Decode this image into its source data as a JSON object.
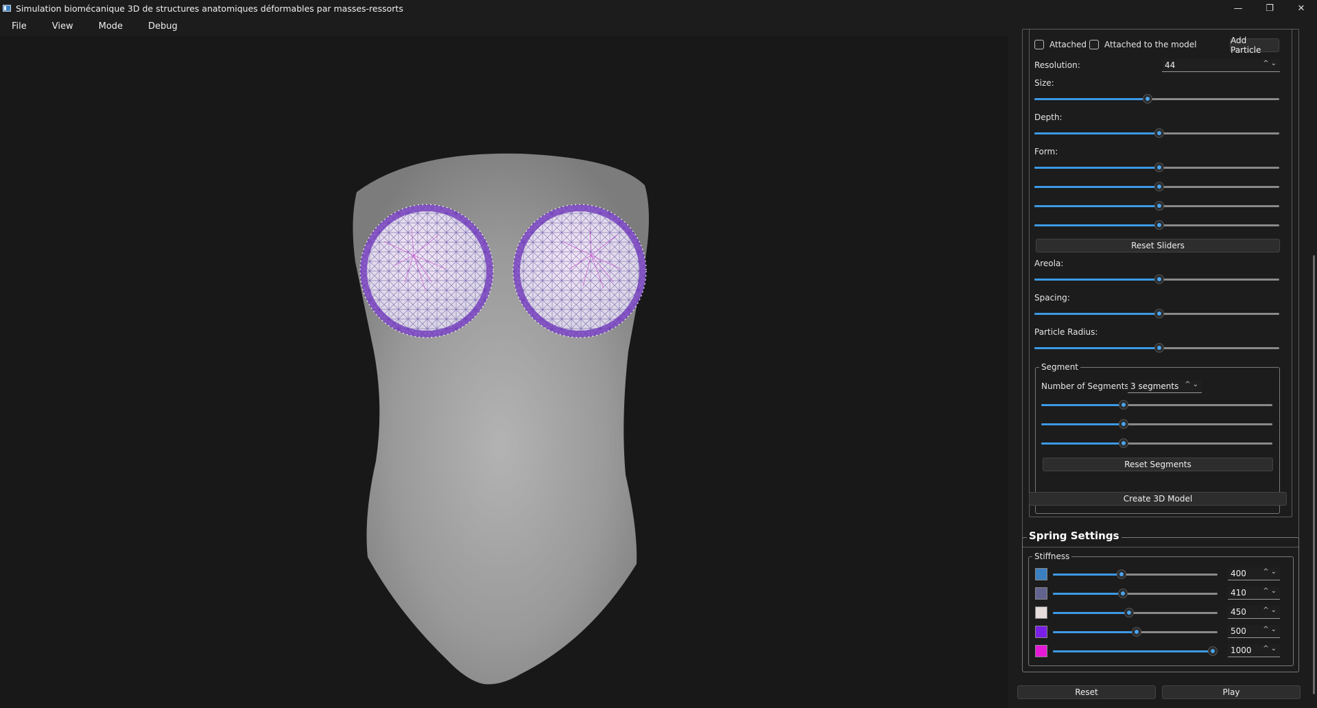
{
  "window": {
    "title": "Simulation biomécanique 3D de structures anatomiques déformables par masses-ressorts",
    "minimize_glyph": "—",
    "restore_glyph": "❐",
    "close_glyph": "✕"
  },
  "menu": {
    "items": [
      "File",
      "View",
      "Mode",
      "Debug"
    ]
  },
  "panel": {
    "attached_label": "Attached",
    "attached_model_label": "Attached to the model",
    "add_particle_label": "Add Particle",
    "resolution_label": "Resolution:",
    "resolution_value": "44",
    "size_label": "Size:",
    "size_value": 0.46,
    "depth_label": "Depth:",
    "depth_value": 0.51,
    "form_label": "Form:",
    "form_values": [
      0.51,
      0.51,
      0.51,
      0.51
    ],
    "reset_sliders_label": "Reset Sliders",
    "areola_label": "Areola:",
    "areola_value": 0.51,
    "spacing_label": "Spacing:",
    "spacing_value": 0.51,
    "particle_radius_label": "Particle Radius:",
    "particle_radius_value": 0.51,
    "segment_group_label": "Segment",
    "num_segments_label": "Number of Segments:",
    "num_segments_value": "3 segments",
    "segment_values": [
      0.35,
      0.35,
      0.35
    ],
    "reset_segments_label": "Reset Segments",
    "create_model_label": "Create 3D Model",
    "spring_settings_label": "Spring Settings",
    "stiffness_label": "Stiffness",
    "springs": [
      {
        "color": "#3a7fbf",
        "value": "400",
        "level": 0.41
      },
      {
        "color": "#62638f",
        "value": "410",
        "level": 0.42
      },
      {
        "color": "#e6dcdc",
        "value": "450",
        "level": 0.46
      },
      {
        "color": "#7a1fe6",
        "value": "500",
        "level": 0.51
      },
      {
        "color": "#e619d6",
        "value": "1000",
        "level": 1.0
      }
    ],
    "reset_label": "Reset",
    "play_label": "Play"
  }
}
